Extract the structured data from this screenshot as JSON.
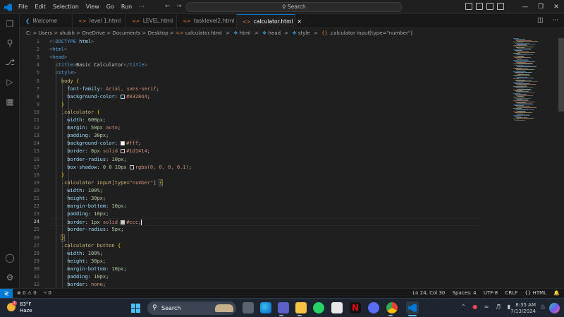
{
  "titlebar": {
    "menu": [
      "File",
      "Edit",
      "Selection",
      "View",
      "Go",
      "Run",
      "···"
    ],
    "back": "←",
    "forward": "→",
    "search": "Search"
  },
  "tabs": [
    {
      "label": "Welcome",
      "icon": "vscode-icon"
    },
    {
      "label": "level 1.html",
      "icon": "html-icon"
    },
    {
      "label": "LEVEL.html",
      "icon": "html-icon"
    },
    {
      "label": "tasklevel2.html",
      "icon": "html-icon"
    },
    {
      "label": "calculator.html",
      "icon": "html-icon",
      "active": true
    }
  ],
  "breadcrumb": {
    "path": "C: > Users > shubh > OneDrive > Documents > Desktop >",
    "file": "calculator.html",
    "rest": [
      ">",
      "html",
      ">",
      "head",
      ">",
      "style",
      ">"
    ],
    "selector": ".calculator input[type=\"number\"]"
  },
  "editor": {
    "current_line": 24,
    "line_numbers": [
      "1",
      "2",
      "3",
      "4",
      "5",
      "6",
      "7",
      "8",
      "9",
      "10",
      "11",
      "12",
      "13",
      "14",
      "15",
      "16",
      "17",
      "18",
      "19",
      "20",
      "21",
      "22",
      "23",
      "24",
      "25",
      "26",
      "27",
      "28",
      "29",
      "30",
      "31",
      "32"
    ]
  },
  "colors": {
    "accent": "#0078d4",
    "html_icon": "#e37933",
    "status_bg": "#181818",
    "taskbar_bg": "#1c2530",
    "swatch_032844": "#032844",
    "swatch_fff": "#ffffff",
    "swatch_1d1414": "#1d1414",
    "swatch_rgba": "rgba(0, 0, 0, 0.1)",
    "swatch_ccc": "#cccccc"
  },
  "statusbar": {
    "remote": "≷",
    "problems": "⊗ 0 ⚠ 0",
    "ports": "⑂ 0",
    "position": "Ln 24, Col 30",
    "spaces": "Spaces: 4",
    "encoding": "UTF-8",
    "eol": "CRLF",
    "language": "{} HTML",
    "bell": "🔔"
  },
  "taskbar": {
    "weather_temp": "83°F",
    "weather_cond": "Haze",
    "weather_badge": "1",
    "search": "Search",
    "time": "8:35 AM",
    "date": "7/13/2024"
  }
}
